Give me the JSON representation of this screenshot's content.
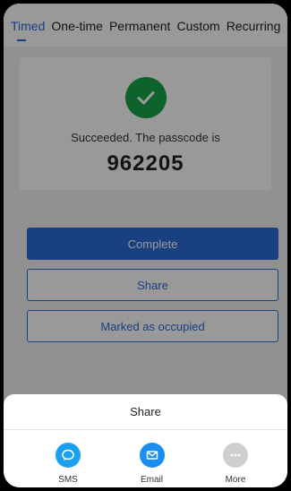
{
  "tabs": [
    {
      "label": "Timed",
      "active": true
    },
    {
      "label": "One-time",
      "active": false
    },
    {
      "label": "Permanent",
      "active": false
    },
    {
      "label": "Custom",
      "active": false
    },
    {
      "label": "Recurring",
      "active": false
    }
  ],
  "result": {
    "message": "Succeeded. The passcode is",
    "passcode": "962205"
  },
  "actions": {
    "complete_label": "Complete",
    "share_label": "Share",
    "occupied_label": "Marked as occupied"
  },
  "share_sheet": {
    "title": "Share",
    "options": [
      {
        "label": "SMS",
        "icon": "sms-icon",
        "color": "#1aa0f0"
      },
      {
        "label": "Email",
        "icon": "email-icon",
        "color": "#1a8ff0"
      },
      {
        "label": "More",
        "icon": "more-icon",
        "color": "#cfcfcf"
      }
    ]
  },
  "colors": {
    "accent": "#2a6bd8",
    "success": "#18a34a"
  }
}
